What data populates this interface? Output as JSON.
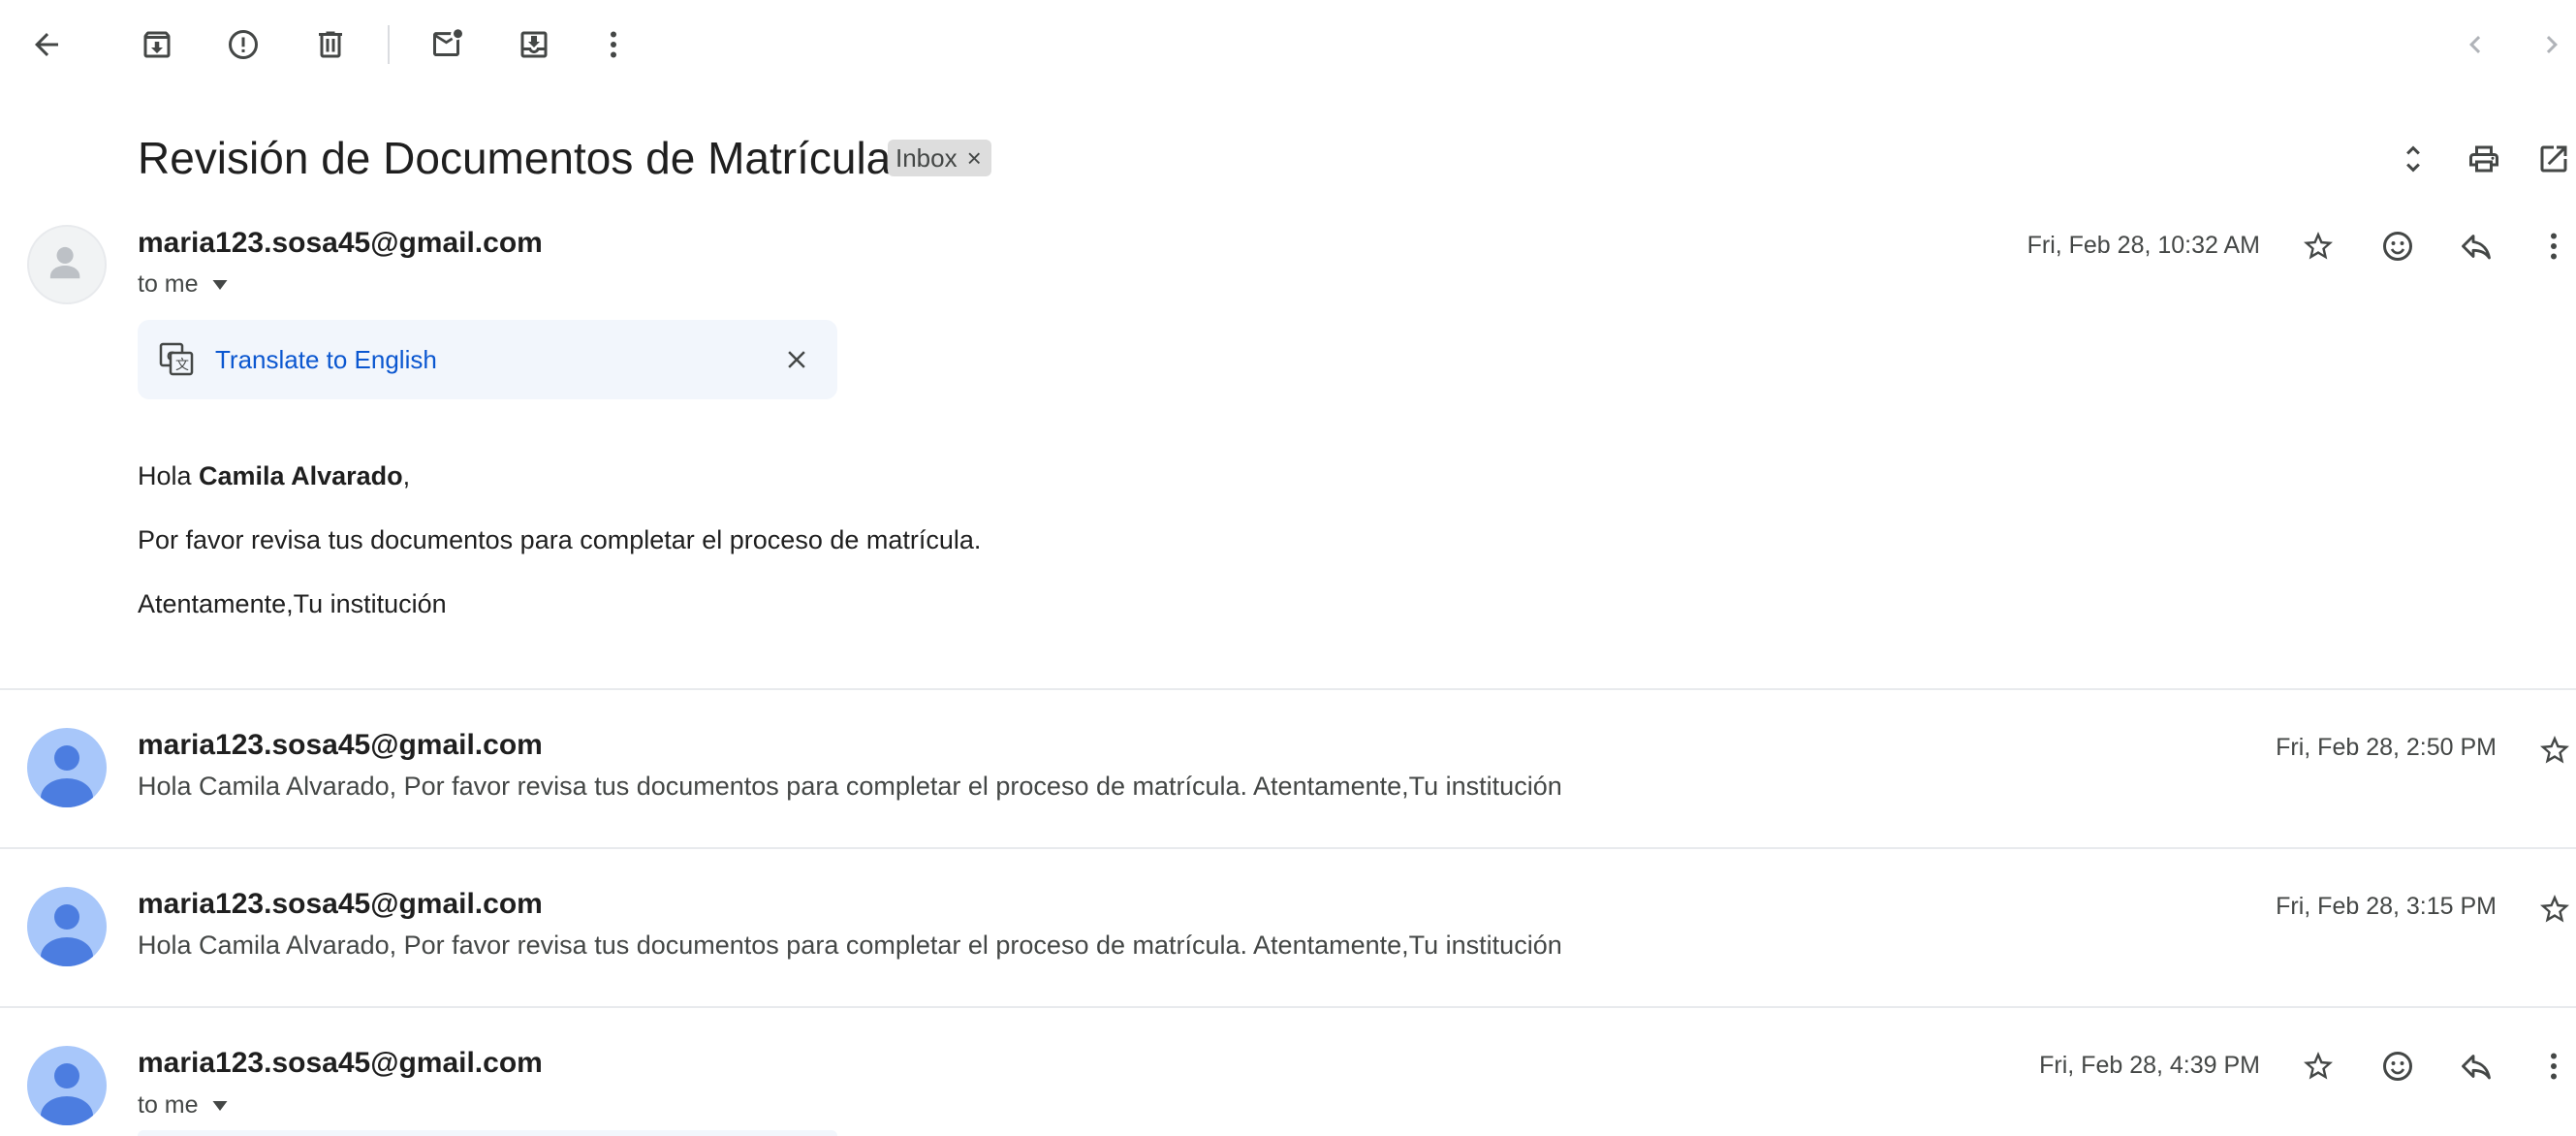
{
  "toolbar": {
    "back_icon": "arrow-left-icon",
    "archive_icon": "archive-icon",
    "spam_icon": "report-spam-icon",
    "delete_icon": "trash-icon",
    "mark_unread_icon": "mark-unread-icon",
    "move_icon": "move-to-inbox-icon",
    "more_icon": "more-vertical-icon",
    "prev_icon": "chevron-left-icon",
    "next_icon": "chevron-right-icon"
  },
  "thread": {
    "subject": "Revisión de Documentos de Matrícula",
    "label": "Inbox",
    "label_remove": "×"
  },
  "messages": [
    {
      "sender": "maria123.sosa45@gmail.com",
      "to": "to me",
      "date": "Fri, Feb 28, 10:32 AM",
      "translate": "Translate to English",
      "greeting_prefix": "Hola ",
      "greeting_name": "Camila Alvarado",
      "greeting_suffix": ",",
      "line2": "Por favor revisa tus documentos para completar el proceso de matrícula.",
      "line3": "Atentamente,Tu institución"
    },
    {
      "sender": "maria123.sosa45@gmail.com",
      "date": "Fri, Feb 28, 2:50 PM",
      "snippet": "Hola Camila Alvarado, Por favor revisa tus documentos para completar el proceso de matrícula. Atentamente,Tu institución"
    },
    {
      "sender": "maria123.sosa45@gmail.com",
      "date": "Fri, Feb 28, 3:15 PM",
      "snippet": "Hola Camila Alvarado, Por favor revisa tus documentos para completar el proceso de matrícula. Atentamente,Tu institución"
    },
    {
      "sender": "maria123.sosa45@gmail.com",
      "to": "to me",
      "date": "Fri, Feb 28, 4:39 PM"
    }
  ],
  "colors": {
    "link": "#0b57d0",
    "avatar_blue": "#a8c7fa",
    "avatar_figure": "#4c7de0",
    "chip_bg": "#dddddd"
  }
}
